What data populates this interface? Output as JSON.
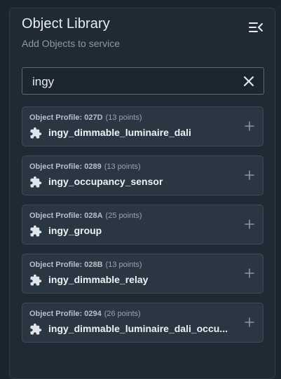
{
  "panel": {
    "title": "Object Library",
    "subtitle": "Add Objects to service",
    "collapse_icon": "menu-collapse-icon"
  },
  "search": {
    "value": "ingy",
    "clear_icon": "close-icon"
  },
  "items": [
    {
      "profile": "Object Profile: 027D",
      "points": "(13 points)",
      "name": "ingy_dimmable_luminaire_dali"
    },
    {
      "profile": "Object Profile: 0289",
      "points": "(13 points)",
      "name": "ingy_occupancy_sensor"
    },
    {
      "profile": "Object Profile: 028A",
      "points": "(25 points)",
      "name": "ingy_group"
    },
    {
      "profile": "Object Profile: 028B",
      "points": "(13 points)",
      "name": "ingy_dimmable_relay"
    },
    {
      "profile": "Object Profile: 0294",
      "points": "(26 points)",
      "name": "ingy_dimmable_luminaire_dali_occu..."
    }
  ],
  "colors": {
    "background": "#1b252f",
    "panel": "#1f2a35",
    "card": "#2a3743",
    "text": "#e6ebef",
    "muted": "#8d9aa6"
  }
}
